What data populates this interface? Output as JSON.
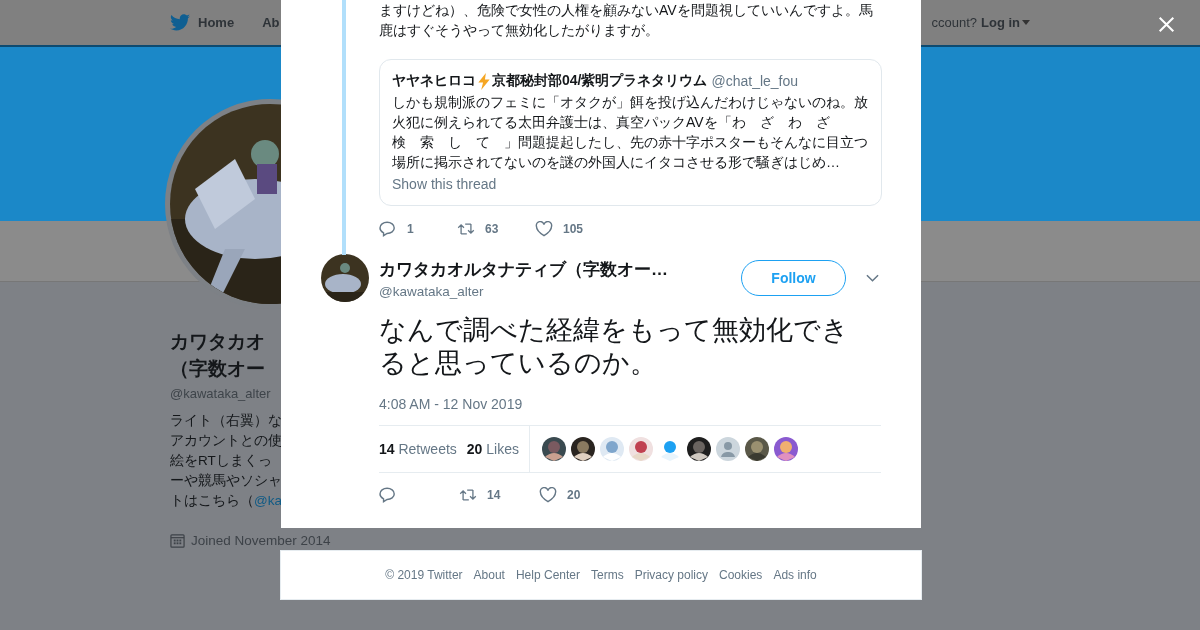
{
  "nav": {
    "items": [
      {
        "label": "Home"
      },
      {
        "label": "Ab"
      }
    ],
    "account_prompt": "ccount?",
    "login": "Log in"
  },
  "profile": {
    "name_lines": [
      "カワタカオ",
      "（字数オー"
    ],
    "handle": "@kawataka_alter",
    "bio_lines": [
      "ライト（右翼）な",
      "アカウントとの使",
      "絵をRTしまくっ",
      "ーや競馬やソシャ"
    ],
    "bio_last": "トはこちら（",
    "bio_link": "@ka",
    "joined": "Joined November 2014"
  },
  "thread_tweet": {
    "text": "ますけどね）、危険で女性の人権を顧みないAVを問題視していいんですよ。馬鹿はすぐそうやって無効化したがりますが。",
    "quote": {
      "name_before": "ヤヤネヒロコ",
      "name_after": "京都秘封部04/紫明プラネタリウム",
      "handle": "@chat_le_fou",
      "text_lines": [
        "しかも規制派のフェミに「オタクが」餌を投げ込んだわけじゃないのね。放",
        "火犯に例えられてる太田弁護士は、真空パックAVを「わ　ざ　わ　ざ",
        "検　索　し　て　」問題提起したし、先の赤十字ポスターもそんなに目立つ",
        "場所に掲示されてないのを謎の外国人にイタコさせる形で騒ぎはじめ…"
      ],
      "show_thread": "Show this thread"
    },
    "actions": [
      {
        "kind": "reply",
        "count": "1"
      },
      {
        "kind": "retweet",
        "count": "63"
      },
      {
        "kind": "like",
        "count": "105"
      }
    ]
  },
  "main_tweet": {
    "name": "カワタカオルタナティブ（字数オー…",
    "handle": "@kawataka_alter",
    "follow": "Follow",
    "text": "なんで調べた経緯をもって無効化できると思っているのか。",
    "time": "4:08 AM - 12 Nov 2019",
    "stats": [
      {
        "count": "14",
        "label": "Retweets"
      },
      {
        "count": "20",
        "label": "Likes"
      }
    ],
    "likers": [
      {
        "kind": "picture"
      },
      {
        "kind": "picture"
      },
      {
        "kind": "picture"
      },
      {
        "kind": "picture"
      },
      {
        "kind": "picture"
      },
      {
        "kind": "picture"
      },
      {
        "kind": "default"
      },
      {
        "kind": "picture"
      },
      {
        "kind": "picture"
      }
    ],
    "actions": [
      {
        "kind": "reply"
      },
      {
        "kind": "retweet",
        "count": "14"
      },
      {
        "kind": "like",
        "count": "20"
      }
    ]
  },
  "footer": [
    "© 2019 Twitter",
    "About",
    "Help Center",
    "Terms",
    "Privacy policy",
    "Cookies",
    "Ads info"
  ]
}
